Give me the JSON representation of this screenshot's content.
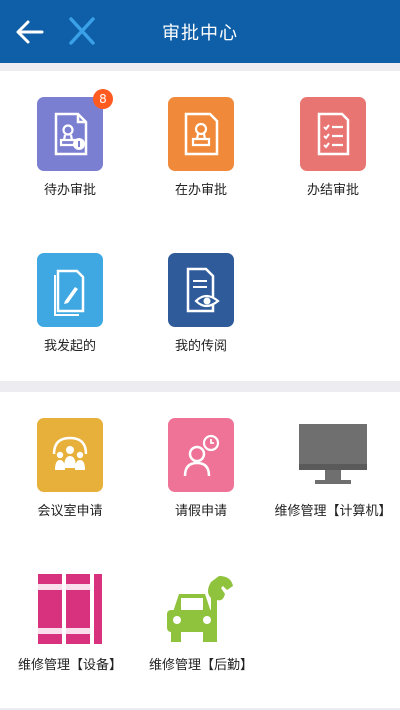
{
  "header": {
    "title": "审批中心"
  },
  "colors": {
    "header": "#0e5fa7",
    "accent": "#3aa0e8"
  },
  "approval": [
    {
      "label": "待办审批",
      "badge": "8",
      "color": "#7b7fd1",
      "icon": "stamp-document-icon"
    },
    {
      "label": "在办审批",
      "color": "#f08a3a",
      "icon": "stamp-document-icon"
    },
    {
      "label": "办结审批",
      "color": "#e97572",
      "icon": "checklist-document-icon"
    },
    {
      "label": "我发起的",
      "color": "#3fa8e3",
      "icon": "edit-document-icon"
    },
    {
      "label": "我的传阅",
      "color": "#2f5b9a",
      "icon": "view-document-icon"
    }
  ],
  "apps": [
    {
      "label": "会议室申请",
      "color": "#e7b03a",
      "icon": "meeting-people-icon"
    },
    {
      "label": "请假申请",
      "color": "#ee7397",
      "icon": "leave-person-clock-icon"
    },
    {
      "label": "维修管理【计算机】",
      "color": "#6f6f6f",
      "icon": "computer-monitor-icon"
    },
    {
      "label": "维修管理【设备】",
      "color": "#d8317d",
      "icon": "equipment-binders-icon"
    },
    {
      "label": "维修管理【后勤】",
      "color": "#8fc23d",
      "icon": "car-wrench-icon"
    }
  ]
}
